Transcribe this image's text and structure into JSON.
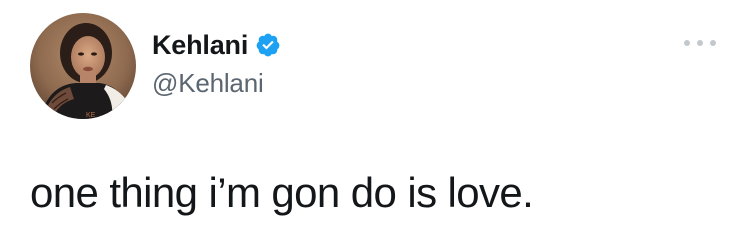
{
  "author": {
    "display_name": "Kehlani",
    "handle": "@Kehlani",
    "verified": true,
    "verified_color": "#1da1f2"
  },
  "tweet": {
    "text": "one thing i’m gon do is love."
  },
  "menu": {
    "icon": "more-horizontal-icon"
  }
}
